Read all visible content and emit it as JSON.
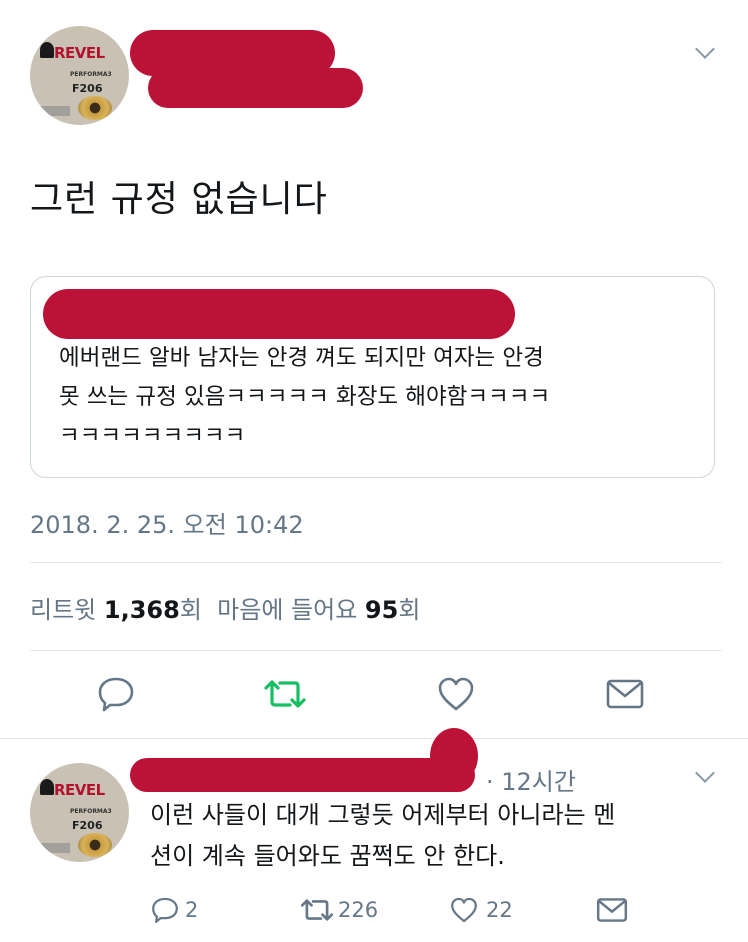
{
  "main_tweet": {
    "avatar": {
      "brand": "REVEL",
      "sub": "PERFORMA3",
      "model": "F206"
    },
    "text": "그런 규정 없습니다",
    "quoted": {
      "text": "에버랜드 알바 남자는 안경 껴도 되지만 여자는 안경\n못 쓰는 규정 있음ㅋㅋㅋㅋㅋ 화장도 해야함ㅋㅋㅋㅋ\nㅋㅋㅋㅋㅋㅋㅋㅋㅋ"
    },
    "timestamp": "2018. 2. 25. 오전 10:42",
    "stats": {
      "retweet_label": "리트윗",
      "retweet_count": "1,368",
      "retweet_unit": "회",
      "like_label": "마음에 들어요",
      "like_count": "95",
      "like_unit": "회"
    },
    "actions": [
      "reply-icon",
      "retweet-icon",
      "heart-icon",
      "message-icon"
    ]
  },
  "reply_tweet": {
    "avatar": {
      "brand": "REVEL",
      "sub": "PERFORMA3",
      "model": "F206"
    },
    "meta": "· 12시간",
    "text": "이런 사들이 대개 그렇듯 어제부터 아니라는 멘\n션이 계속 들어와도 꿈쩍도 안 한다.",
    "counts": {
      "replies": "2",
      "retweets": "226",
      "likes": "22"
    }
  },
  "colors": {
    "retweet_green": "#17bf63",
    "icon_gray": "#657786",
    "redaction": "#bc1238"
  }
}
